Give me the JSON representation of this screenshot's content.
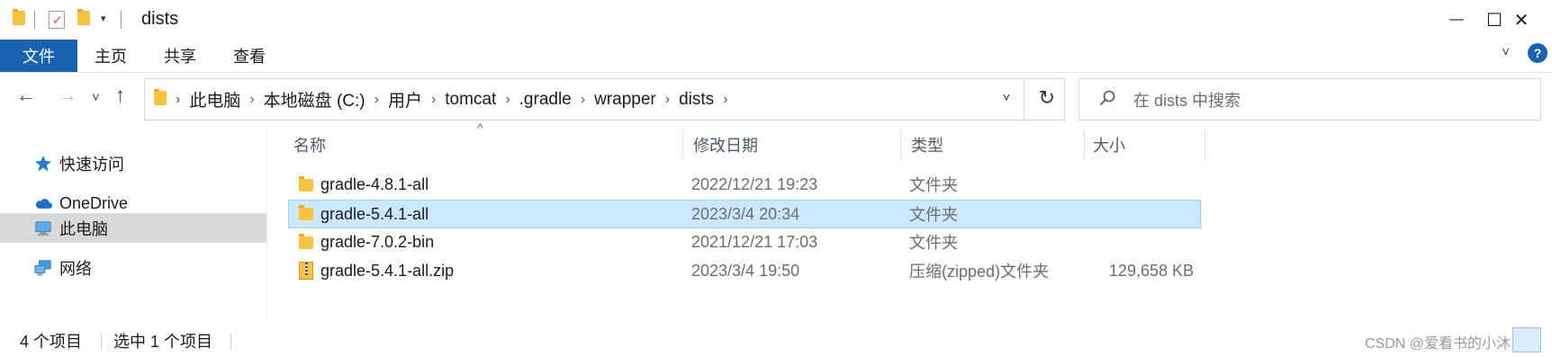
{
  "window": {
    "title": "dists",
    "minimize_glyph": "—",
    "maximize_glyph": "☐",
    "close_glyph": "✕"
  },
  "ribbon": {
    "tabs": [
      {
        "label": "文件",
        "active": true
      },
      {
        "label": "主页",
        "active": false
      },
      {
        "label": "共享",
        "active": false
      },
      {
        "label": "查看",
        "active": false
      }
    ],
    "help_glyph": "?"
  },
  "navigation": {
    "back_glyph": "←",
    "forward_glyph": "→",
    "recent_glyph": "˅",
    "up_glyph": "↑",
    "breadcrumbs": [
      "此电脑",
      "本地磁盘 (C:)",
      "用户",
      "tomcat",
      ".gradle",
      "wrapper",
      "dists"
    ],
    "crumb_separator": "›",
    "refresh_glyph": "↻",
    "dropdown_glyph": "˅"
  },
  "search": {
    "placeholder": "在 dists 中搜索"
  },
  "nav_pane": {
    "items": [
      {
        "label": "快速访问",
        "icon": "star-icon",
        "selected": false
      },
      {
        "label": "OneDrive",
        "icon": "cloud-icon",
        "selected": false
      },
      {
        "label": "此电脑",
        "icon": "computer-icon",
        "selected": true
      },
      {
        "label": "网络",
        "icon": "network-icon",
        "selected": false
      }
    ]
  },
  "file_list": {
    "sort_glyph": "^",
    "columns": {
      "name": "名称",
      "date": "修改日期",
      "type": "类型",
      "size": "大小"
    },
    "rows": [
      {
        "name": "gradle-4.8.1-all",
        "date": "2022/12/21 19:23",
        "type": "文件夹",
        "size": "",
        "icon": "folder-icon",
        "selected": false
      },
      {
        "name": "gradle-5.4.1-all",
        "date": "2023/3/4 20:34",
        "type": "文件夹",
        "size": "",
        "icon": "folder-icon",
        "selected": true
      },
      {
        "name": "gradle-7.0.2-bin",
        "date": "2021/12/21 17:03",
        "type": "文件夹",
        "size": "",
        "icon": "folder-icon",
        "selected": false
      },
      {
        "name": "gradle-5.4.1-all.zip",
        "date": "2023/3/4 19:50",
        "type": "压缩(zipped)文件夹",
        "size": "129,658 KB",
        "icon": "zip-folder-icon",
        "selected": false
      }
    ]
  },
  "status_bar": {
    "item_count": "4 个项目",
    "selected_count": "选中 1 个项目",
    "watermark": "CSDN @爱看书的小沐"
  },
  "colors": {
    "file_tab_bg": "#1a62b2",
    "selection_bg": "#cce8ff",
    "selection_border": "#99d1ff",
    "nav_selected_bg": "#d9d9d9",
    "folder_yellow": "#f6c342"
  }
}
